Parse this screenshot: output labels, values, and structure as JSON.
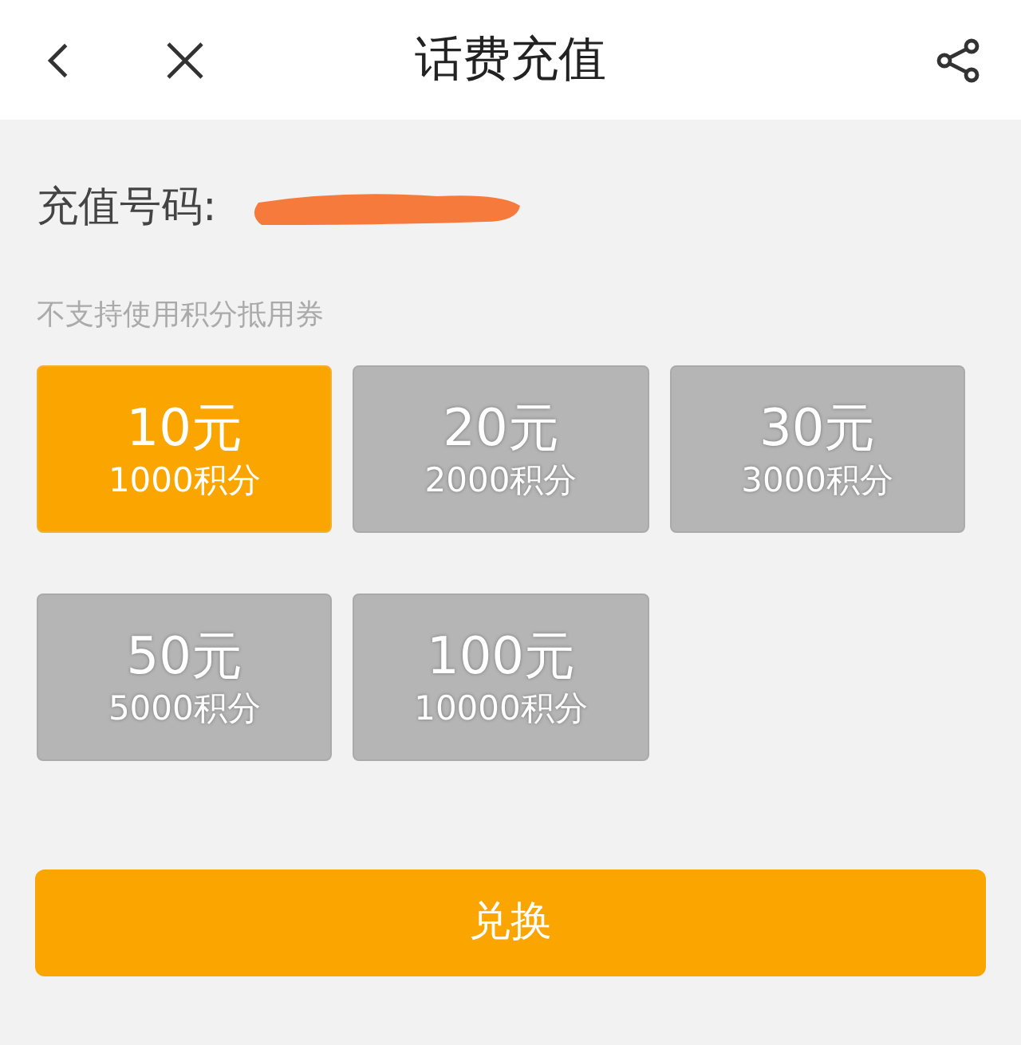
{
  "header": {
    "title": "话费充值"
  },
  "recharge_number": {
    "label": "充值号码:",
    "redacted": true
  },
  "notice": "不支持使用积分抵用券",
  "options": [
    {
      "amount": "10元",
      "points": "1000积分",
      "selected": true
    },
    {
      "amount": "20元",
      "points": "2000积分",
      "selected": false
    },
    {
      "amount": "30元",
      "points": "3000积分",
      "selected": false
    },
    {
      "amount": "50元",
      "points": "5000积分",
      "selected": false
    },
    {
      "amount": "100元",
      "points": "10000积分",
      "selected": false
    }
  ],
  "submit_button": "兑换"
}
